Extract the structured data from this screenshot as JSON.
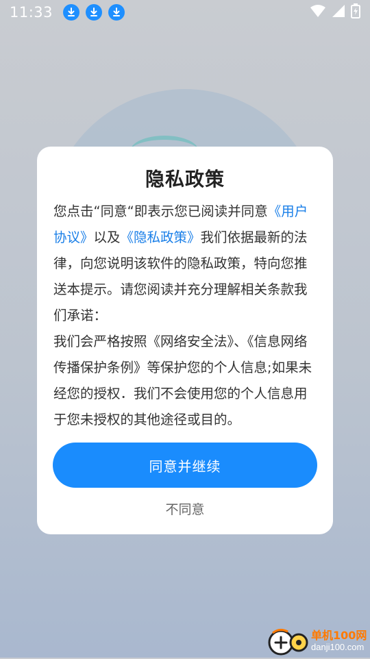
{
  "status_bar": {
    "time": "11:33",
    "download_icons": [
      "download-icon",
      "download-icon",
      "download-icon"
    ],
    "right_icons": [
      "wifi-icon",
      "cellular-signal-icon",
      "battery-charging-icon"
    ]
  },
  "dialog": {
    "title": "隐私政策",
    "body_part1": "您点击“同意“即表示您已阅读并同意",
    "user_agreement_link": "《用户协议》",
    "body_part2": "以及",
    "privacy_policy_link": "《隐私政策》",
    "body_part3": "我们依据最新的法律，向您说明该软件的隐私政策，特向您推送本提示。请您阅读并充分理解相关条款我们承诺：",
    "body_part4": "我们会严格按照《网络安全法》、《信息网络传播保护条例》等保护您的个人信息;如果未经您的授权．我们不会使用您的个人信息用于您未授权的其他途径或目的。",
    "agree_button": "同意并继续",
    "disagree_button": "不同意"
  },
  "watermark": {
    "cn": "单机100网",
    "en": "danji100.com"
  },
  "colors": {
    "accent": "#1a8cfd",
    "link": "#1a7fe8",
    "watermark": "#ff7a00"
  }
}
